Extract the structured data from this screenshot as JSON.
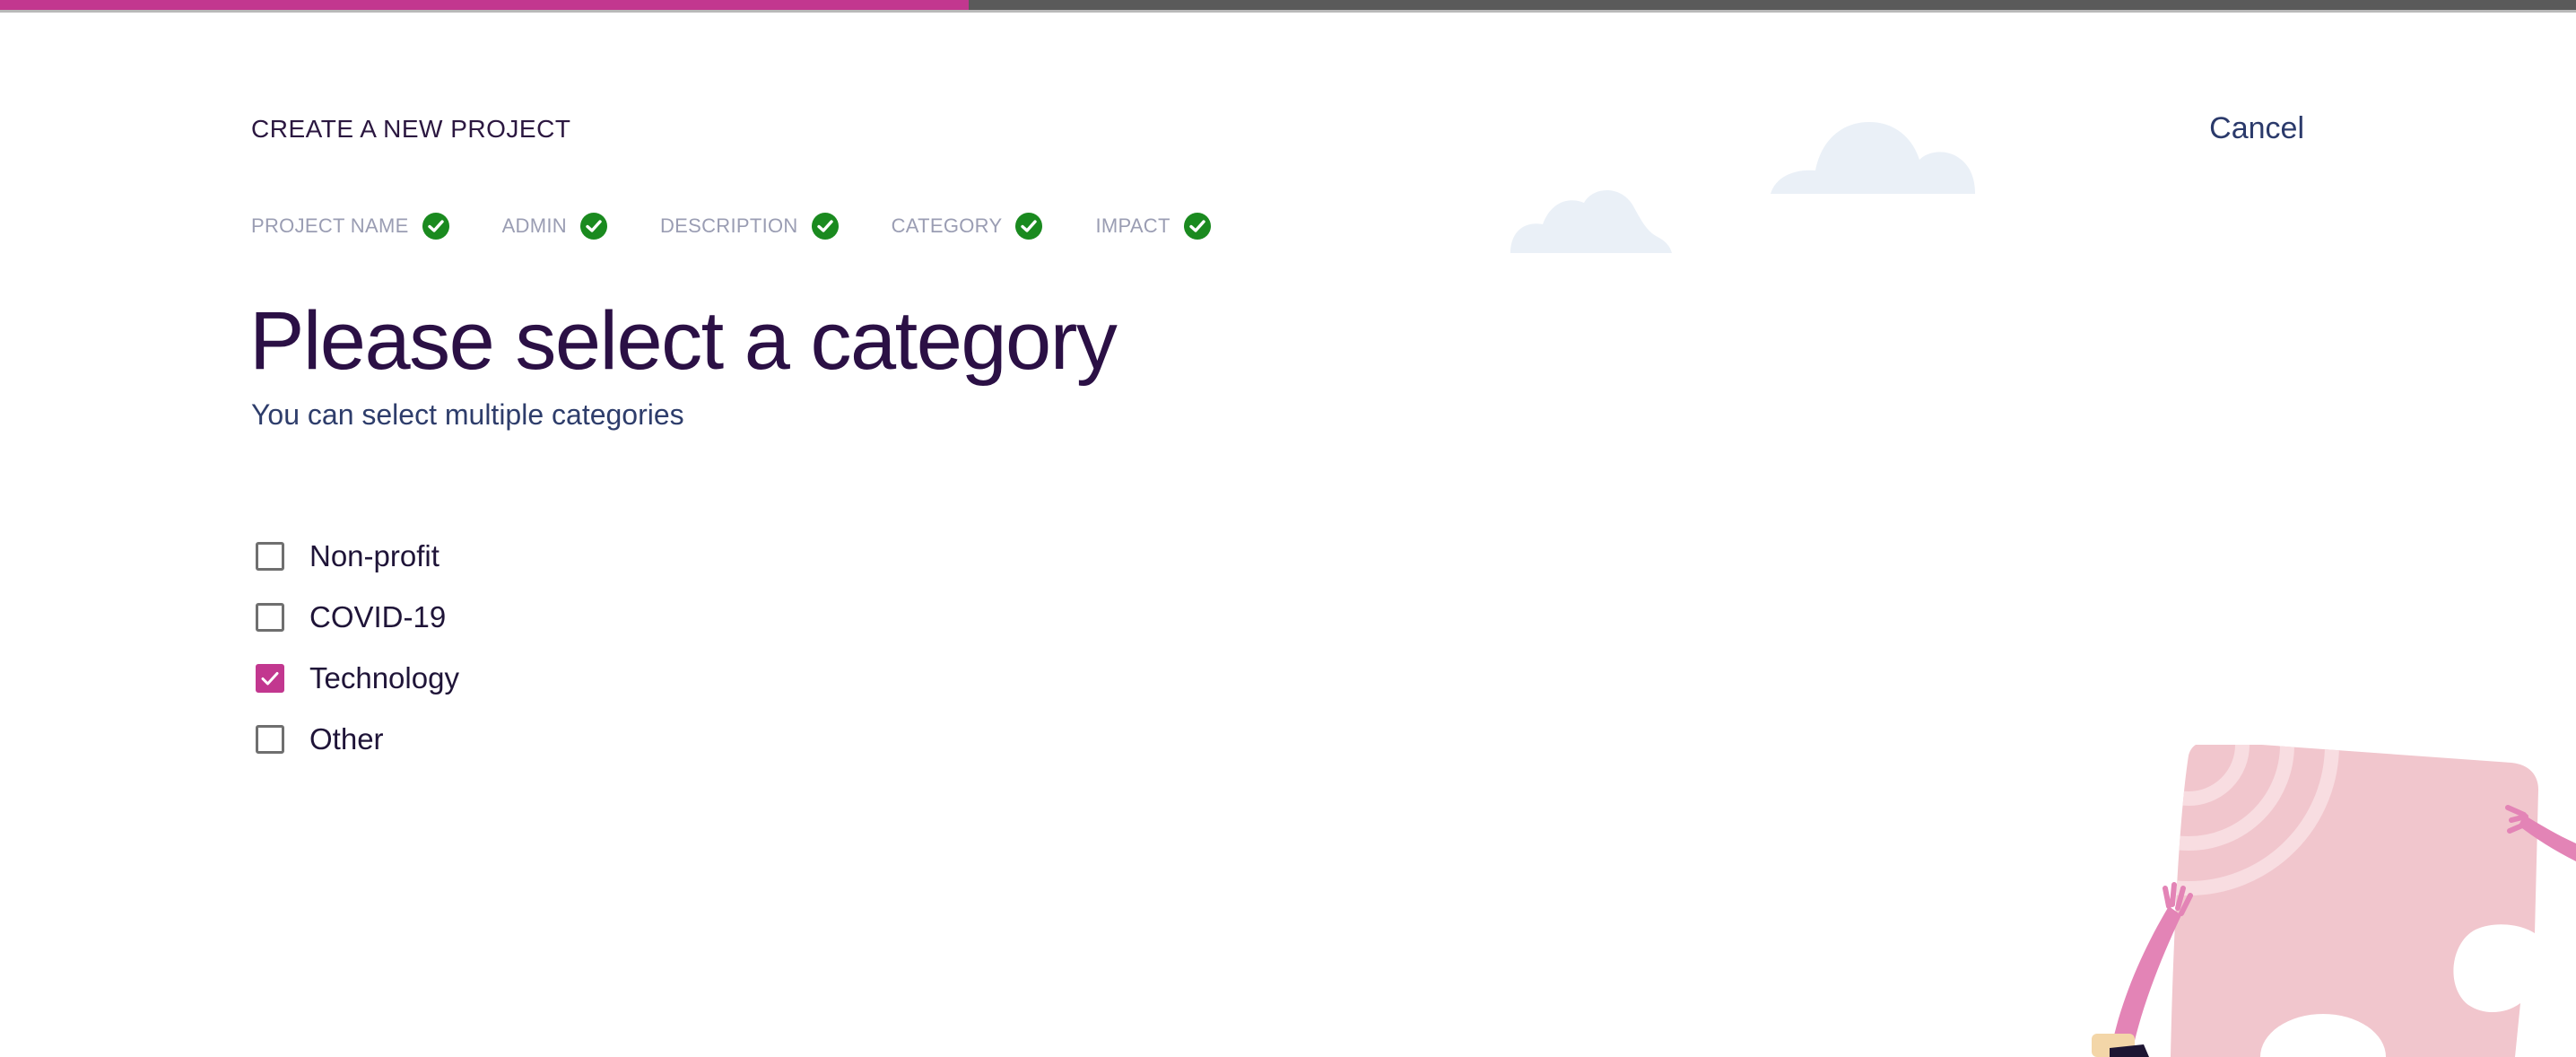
{
  "progress": {
    "percent": 37.6,
    "fill_color": "#c2378f"
  },
  "header": {
    "title": "CREATE A NEW PROJECT",
    "cancel_label": "Cancel"
  },
  "steps": [
    {
      "label": "PROJECT NAME",
      "status": "complete",
      "icon": "check-circle-icon"
    },
    {
      "label": "ADMIN",
      "status": "complete",
      "icon": "check-circle-icon"
    },
    {
      "label": "DESCRIPTION",
      "status": "complete",
      "icon": "check-circle-icon"
    },
    {
      "label": "CATEGORY",
      "status": "complete",
      "icon": "check-circle-icon"
    },
    {
      "label": "IMPACT",
      "status": "complete",
      "icon": "check-circle-icon"
    }
  ],
  "main": {
    "title": "Please select a category",
    "subtitle": "You can select multiple categories",
    "options": [
      {
        "label": "Non-profit",
        "checked": false
      },
      {
        "label": "COVID-19",
        "checked": false
      },
      {
        "label": "Technology",
        "checked": true
      },
      {
        "label": "Other",
        "checked": false
      }
    ]
  },
  "colors": {
    "accent": "#c2378f",
    "step_check": "#1a8a1f",
    "heading": "#2b1045"
  },
  "icons": {
    "cloud": "cloud-icon",
    "illustration": "puzzle-piece-illustration"
  }
}
